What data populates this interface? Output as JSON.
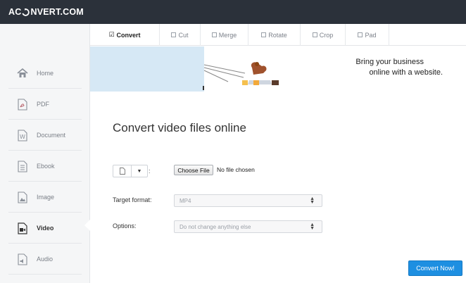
{
  "app": {
    "logo_prefix": "AC",
    "logo_suffix": "NVERT.COM"
  },
  "tabs": [
    {
      "label": "Convert",
      "checked": true
    },
    {
      "label": "Cut",
      "checked": false
    },
    {
      "label": "Merge",
      "checked": false
    },
    {
      "label": "Rotate",
      "checked": false
    },
    {
      "label": "Crop",
      "checked": false
    },
    {
      "label": "Pad",
      "checked": false
    }
  ],
  "sidebar": {
    "items": [
      {
        "label": "Home",
        "icon": "home-icon"
      },
      {
        "label": "PDF",
        "icon": "pdf-icon"
      },
      {
        "label": "Document",
        "icon": "document-icon"
      },
      {
        "label": "Ebook",
        "icon": "ebook-icon"
      },
      {
        "label": "Image",
        "icon": "image-icon"
      },
      {
        "label": "Video",
        "icon": "video-icon",
        "active": true
      },
      {
        "label": "Audio",
        "icon": "audio-icon"
      }
    ]
  },
  "banner": {
    "line1": "Bring your business",
    "line2": "online with a website."
  },
  "main": {
    "title": "Convert video files online",
    "file_button": "Choose File",
    "file_status": "No file chosen",
    "colon": ":",
    "target_label": "Target format:",
    "target_value": "MP4",
    "options_label": "Options:",
    "options_value": "Do not change anything else",
    "convert_button": "Convert Now!"
  },
  "colors": {
    "topbar": "#2b313a",
    "accent": "#1e8fe1",
    "banner_blue": "#d6e8f5"
  }
}
